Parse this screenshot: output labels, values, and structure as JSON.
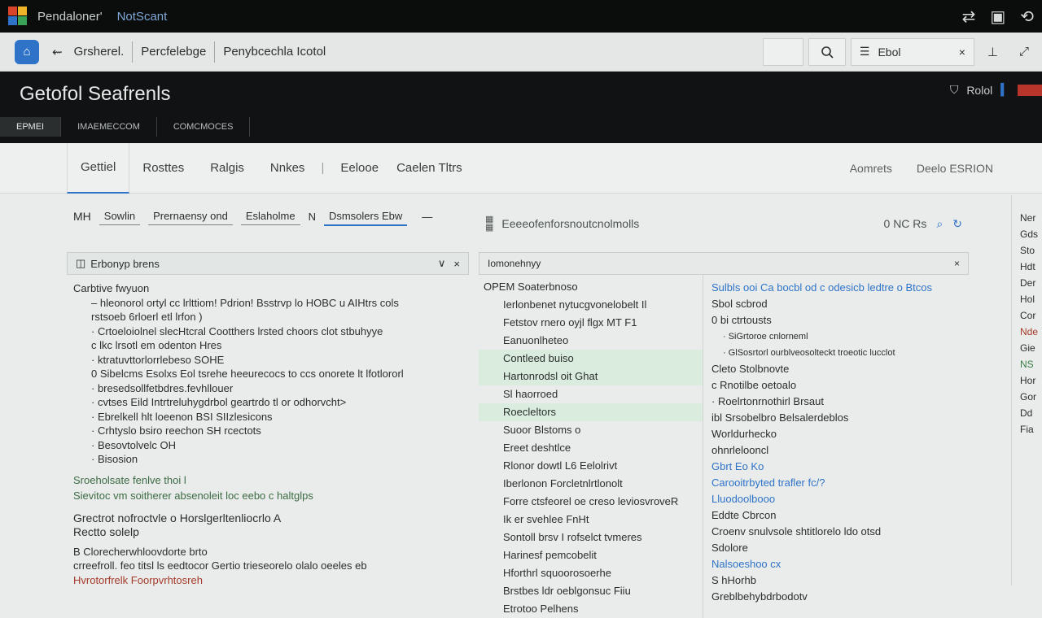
{
  "window": {
    "title": "Pendaloner'",
    "brand": "NotScant",
    "actions": [
      "⇄",
      "▣",
      "⟲"
    ]
  },
  "toolbar": {
    "items": [
      "Grsherel.",
      "Percfelebge",
      "Penybcechla Icotol"
    ],
    "search_label": "Ebol"
  },
  "header": {
    "title": "Getofol Seafrenls",
    "sub_tabs": [
      "ЕРМЕІ",
      "ІМАЕМЕССОМ",
      "СОМСМОСЕS"
    ],
    "right_label": "Rolol"
  },
  "nav": {
    "tabs": [
      "Gettiel",
      "Rosttes",
      "Ralgis",
      "Nnkes"
    ],
    "extra": "Eelooe",
    "extra2": "Caelen Tltrs",
    "right": [
      "Aomrets",
      "Deelo ESRION"
    ]
  },
  "filters": {
    "items": [
      "MH",
      "Sowlin",
      "Prernaensy ond",
      "Eslaholme",
      "N",
      "Dsmsolers Ebw"
    ]
  },
  "left_section": {
    "title": "Erbonyp brens",
    "lines": [
      "Carbtive fwyuon",
      "– hleonorol ortyl cc lrlttiom! Pdrion! Bsstrvp lo HOBC u AIHtrs cols",
      "rstsoeb 6rloerl etl lrfon )",
      "· Crtoeloiolnel slecHtcral Cootthers lrsted choors clot stbuhyye",
      "c lkc lrsotl em odenton Hres",
      "· ktratuvttorlorrlebeso SOHE",
      "0 Sibelcms Esolxs Eol tsrehe heeurecocs to ccs onorete lt lfotlororl",
      "· bresedsollfetbdres.fevhllouer",
      "· cvtses Eild Intrtreluhygdrbol geartrdo tl or odhorvcht>",
      "· Ebrelkell hlt loeenon BSI SIIzlesicons",
      "· Crhtyslo bsiro reechon SH rcectots",
      "· Besovtolvelc OH",
      "· Bisosion",
      "Sroeholsate fenlve thoi l",
      "Sievitoc vm soitherer absenoleit loc eebo c haltglps",
      "Grectrot nofroctvle o Horslgerltenliocrlo A",
      "Rectto solelp",
      "B Clorecherwhloovdorte brto",
      "crreefroll. feo titsl ls eedtocor Gertio trieseorelo olalo oeeles eb",
      "Hvrotorfrelk Foorpvrhtosreh"
    ]
  },
  "mid": {
    "header": "Eeeeofenforsnoutcnolmolls",
    "right": "0 NC Rs",
    "section_title": "Iomonehnyy",
    "list": [
      "OPEM Soaterbnoso",
      "Ierlonbenet nytucgvonelobelt Il",
      "Fetstov rnero oyjl flgx MT F1",
      "Eanuonlheteo",
      "Contleed buiso",
      "Hartonrodsl oit Ghat",
      "Sl haorroed",
      "Roecleltors",
      "Suoor Blstoms o",
      "Ereet deshtlce",
      "Rlonor dowtl L6 Eelolrivt",
      "Iberlonon Forcletnlrtlonolt",
      "Forre ctsfeorel oe creso leviosvroveR",
      "Ik er svehlee FnHt",
      "Sontoll brsv I rofselct tvmeres",
      "Harinesf pemcobelit",
      "Hforthrl squoorosoerhe",
      "Brstbes ldr oeblgonsuc Fiiu",
      "Etrotoo Pelhens"
    ],
    "detail": [
      "Sulbls ooi Ca bocbl od c odesicb ledtre o Btcos",
      "Sbol scbrod",
      "0 bi ctrtousts",
      "· SiGrtoroe cnlorneml",
      "· GlSosrtorl ourblveosolteckt troeotic lucclot",
      "Cleto Stolbnovte",
      "c Rnotilbe oetoalo",
      "· Roelrtonrnothirl Brsaut",
      "ibl Srsobelbro Belsalerdeblos",
      "Worldurhecko",
      "ohnrlelooncl",
      "Gbrt Eo Ko",
      "Carooitrbyted trafler fc/?",
      "Lluodoolbooo",
      "Eddte Cbrcon",
      "Croenv snulvsole shtitlorelo ldo otsd",
      "Sdolore",
      "Nalsoeshoo cx",
      "S hHorhb",
      "Greblbehybdrbodotv"
    ]
  },
  "right_panel": {
    "lines": [
      "Ner",
      "Gds",
      "Sto",
      "Hdt",
      "Der",
      "Hol",
      "Cor",
      "Nde",
      "Gie",
      "NS",
      "Hor",
      "Gor",
      "Dd",
      "Fia"
    ]
  },
  "colors": {
    "accent": "#2f73c9",
    "highlight": "#d9ecde",
    "red": "#b8352b"
  }
}
